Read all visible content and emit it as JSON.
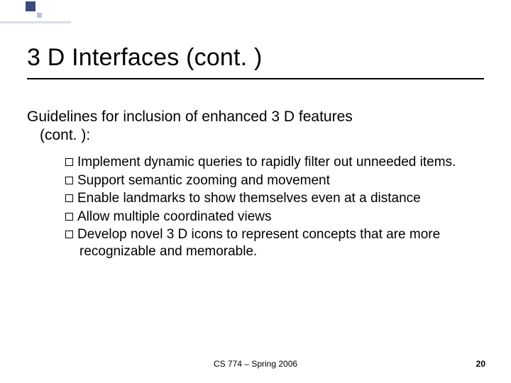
{
  "slide": {
    "title": "3 D Interfaces (cont. )",
    "lead_line1": "Guidelines for inclusion of enhanced 3 D features",
    "lead_line2": "(cont. ):",
    "bullets": [
      "Implement dynamic queries to rapidly filter out unneeded items.",
      "Support semantic zooming and movement",
      "Enable landmarks to show themselves even at a distance",
      "Allow multiple coordinated views",
      "Develop novel 3 D icons to represent concepts that are more recognizable and memorable."
    ]
  },
  "footer": {
    "center": "CS 774 – Spring 2006",
    "page": "20"
  }
}
